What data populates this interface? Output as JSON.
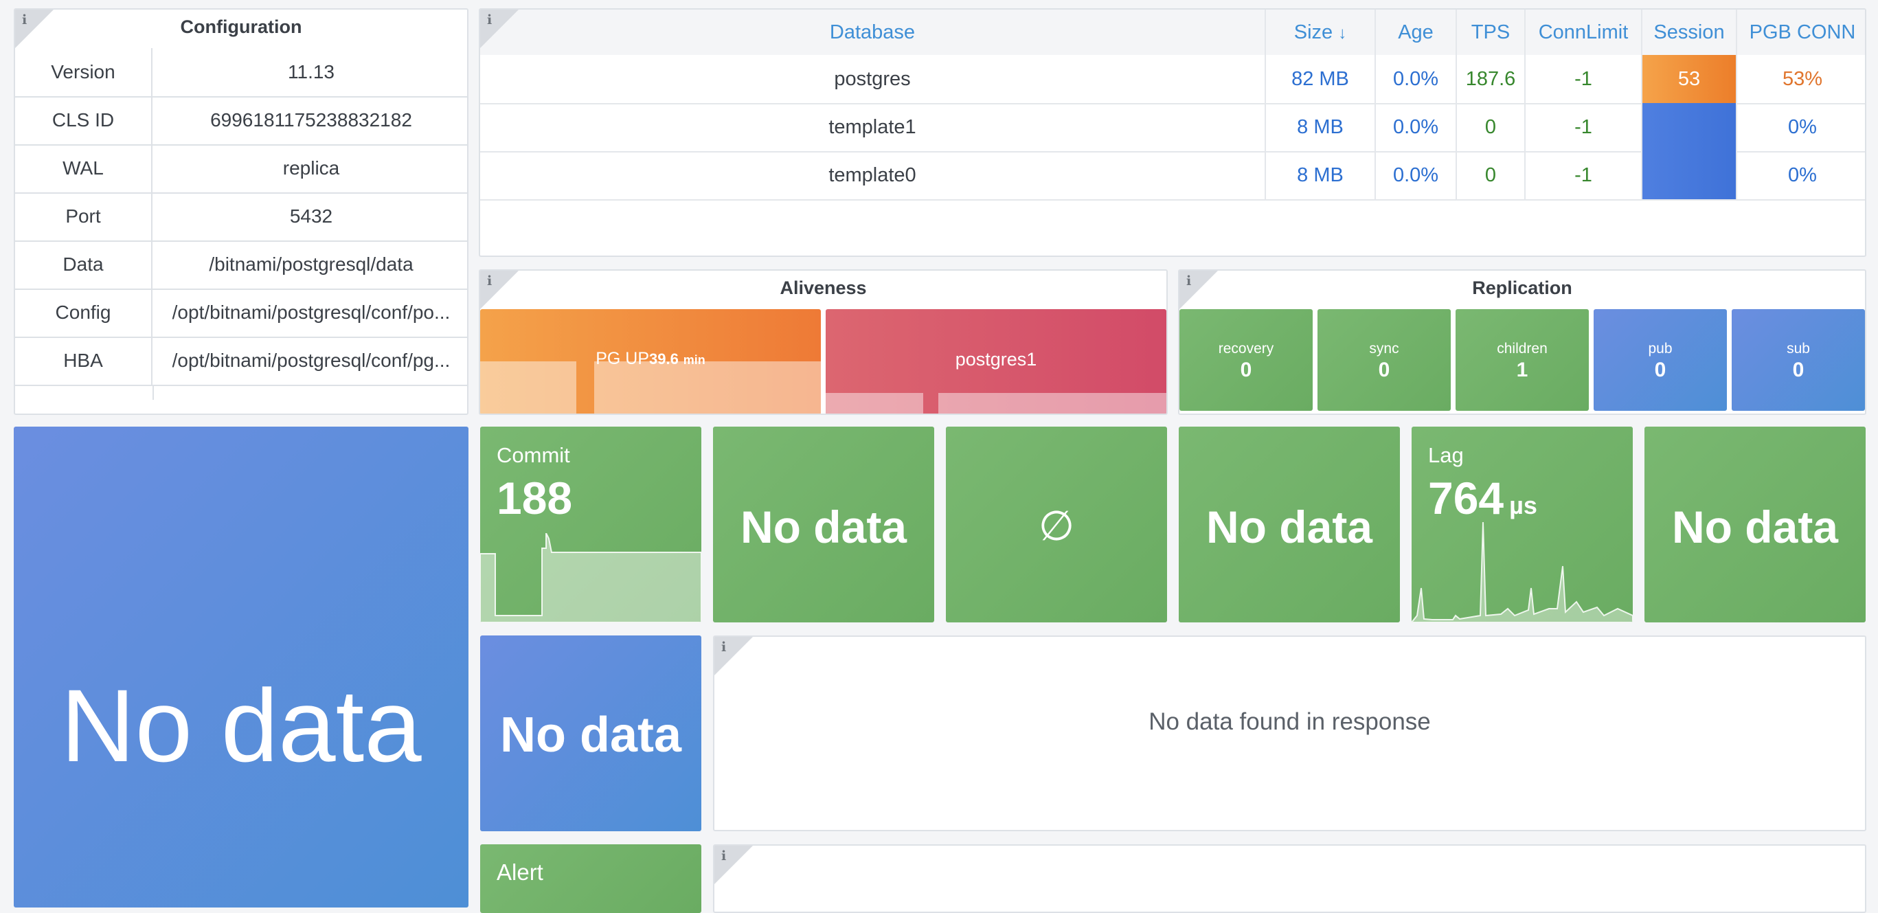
{
  "configuration": {
    "title": "Configuration",
    "rows": [
      {
        "key": "Version",
        "value": "11.13"
      },
      {
        "key": "CLS ID",
        "value": "6996181175238832182"
      },
      {
        "key": "WAL",
        "value": "replica"
      },
      {
        "key": "Port",
        "value": "5432"
      },
      {
        "key": "Data",
        "value": "/bitnami/postgresql/data"
      },
      {
        "key": "Config",
        "value": "/opt/bitnami/postgresql/conf/po..."
      },
      {
        "key": "HBA",
        "value": "/opt/bitnami/postgresql/conf/pg..."
      }
    ]
  },
  "database_table": {
    "headers": {
      "database": "Database",
      "size": "Size",
      "size_sort_arrow": "↓",
      "age": "Age",
      "tps": "TPS",
      "connlimit": "ConnLimit",
      "session": "Session",
      "pgb_conn": "PGB CONN"
    },
    "rows": [
      {
        "database": "postgres",
        "size": "82 MB",
        "age": "0.0%",
        "tps": "187.6",
        "connlimit": "-1",
        "session": "53",
        "pgb_conn": "53%"
      },
      {
        "database": "template1",
        "size": "8 MB",
        "age": "0.0%",
        "tps": "0",
        "connlimit": "-1",
        "session": "",
        "pgb_conn": "0%"
      },
      {
        "database": "template0",
        "size": "8 MB",
        "age": "0.0%",
        "tps": "0",
        "connlimit": "-1",
        "session": "",
        "pgb_conn": "0%"
      }
    ]
  },
  "aliveness": {
    "title": "Aliveness",
    "pg_up_label": "PG UP",
    "pg_up_value": "39.6",
    "pg_up_unit": "min",
    "instance": "postgres1"
  },
  "replication": {
    "title": "Replication",
    "tiles": [
      {
        "label": "recovery",
        "value": "0"
      },
      {
        "label": "sync",
        "value": "0"
      },
      {
        "label": "children",
        "value": "1"
      },
      {
        "label": "pub",
        "value": "0"
      },
      {
        "label": "sub",
        "value": "0"
      }
    ]
  },
  "stats": {
    "big_nodata": "No data",
    "commit_label": "Commit",
    "commit_value": "188",
    "nodata_1": "No data",
    "empty_symbol": "∅",
    "nodata_2": "No data",
    "lag_label": "Lag",
    "lag_value": "764",
    "lag_unit": "µs",
    "nodata_3": "No data",
    "nodata_4": "No data",
    "no_data_found": "No data found in response",
    "alert_label": "Alert"
  },
  "colors": {
    "stat_green": "#73b36a",
    "stat_blue": "#5b8fdd",
    "session_orange": "#ef8b30",
    "aliveness_orange": "#f08b3a",
    "aliveness_red": "#d9566a",
    "header_link_blue": "#3f8fd6",
    "value_blue": "#2c6fd1",
    "value_green": "#37872d",
    "value_orange": "#e0752d"
  },
  "icons": [
    "info-icon",
    "sort-down-arrow-icon"
  ]
}
